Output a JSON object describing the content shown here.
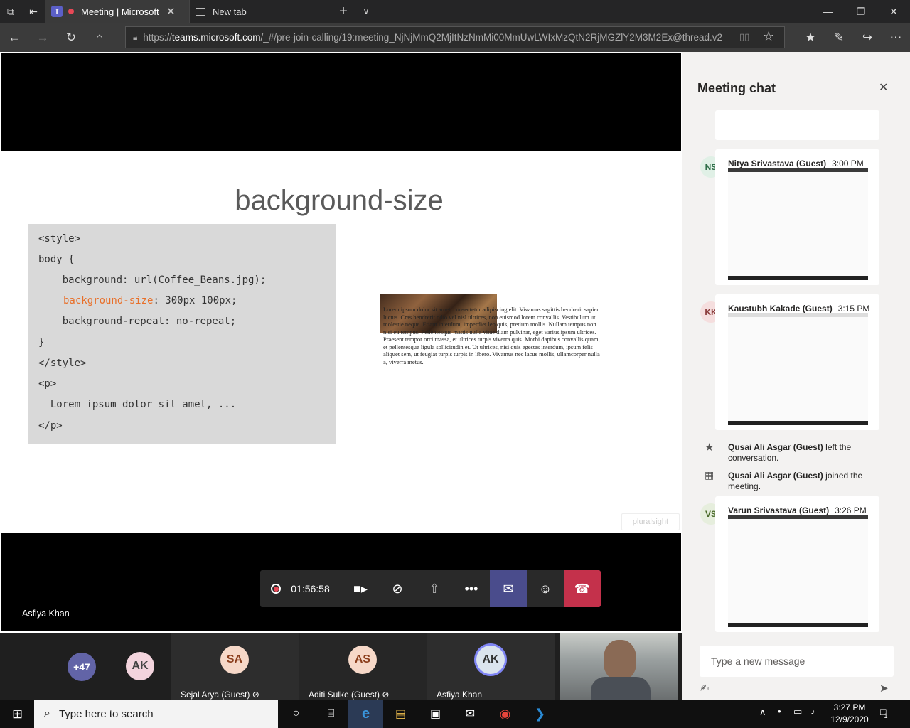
{
  "browser": {
    "tab_active": "Meeting | Microsoft",
    "tab_new": "New tab",
    "url_scheme": "https://",
    "url_host": "teams.microsoft.com",
    "url_path": "/_#/pre-join-calling/19:meeting_NjNjMmQ2MjItNzNmMi00MmUwLWIxMzQtN2RjMGZlY2M3M2Ex@thread.v2"
  },
  "slide": {
    "title": "background-size",
    "code_lines": [
      "<style>",
      "body {",
      "    background: url(Coffee_Beans.jpg);",
      "    background-size: 300px 100px;",
      "    background-repeat: no-repeat;",
      "}",
      "</style>",
      "<p>",
      "  Lorem ipsum dolor sit amet, ...",
      "</p>"
    ],
    "code_highlight": "background-size",
    "code_highlight_rest": ": 300px 100px;",
    "demo_text": "Lorem ipsum dolor sit amet, consectetur adipiscing elit. Vivamus sagittis hendrerit sapien luctus. Cras hendrerit odio vel nisl ultrices, non euismod lorem convallis. Vestibulum ut molestie neque. Etiam interdum, imperdiet leo quis, pretium mollis. Nullam tempus non nisi eu tempus. Pellentesque mattis nulla vitae diam pulvinar, eget varius ipsum ultrices. Praesent tempor orci massa, et ultrices turpis viverra quis. Morbi dapibus convallis quam, et pellentesque ligula sollicitudin et. Ut ultrices, nisi quis egestas interdum, ipsum felis aliquet sem, ut feugiat turpis turpis in libero. Vivamus nec lacus mollis, ullamcorper nulla a, viverra metus.",
    "watermark": "pluralsight"
  },
  "stage": {
    "presenter_name": "Asfiya Khan"
  },
  "controls": {
    "timer": "01:56:58"
  },
  "chat": {
    "title": "Meeting chat",
    "messages": [
      {
        "initials": "NS",
        "name": "Nitya Srivastava (Guest)",
        "time": "3:00 PM"
      },
      {
        "initials": "KK",
        "name": "Kaustubh Kakade (Guest)",
        "time": "3:15 PM"
      },
      {
        "initials": "VS",
        "name": "Varun Srivastava (Guest)",
        "time": "3:26 PM"
      }
    ],
    "events": [
      {
        "who": "Qusai Ali Asgar (Guest)",
        "what": " left the conversation."
      },
      {
        "who": "Qusai Ali Asgar (Guest)",
        "what": " joined the meeting."
      }
    ],
    "compose_placeholder": "Type a new message"
  },
  "participants": {
    "overflow": "+47",
    "tiles": [
      {
        "initials": "AK",
        "name": ""
      },
      {
        "initials": "SA",
        "name": "Sejal Arya (Guest)"
      },
      {
        "initials": "AS",
        "name": "Aditi Sulke (Guest)"
      },
      {
        "initials": "AK",
        "name": "Asfiya Khan"
      }
    ]
  },
  "taskbar": {
    "search_placeholder": "Type here to search",
    "time": "3:27 PM",
    "date": "12/9/2020",
    "notifications": "1"
  },
  "colors": {
    "teams_purple": "#5b5fc7",
    "hangup_red": "#c4314b",
    "code_orange": "#e8702a"
  }
}
